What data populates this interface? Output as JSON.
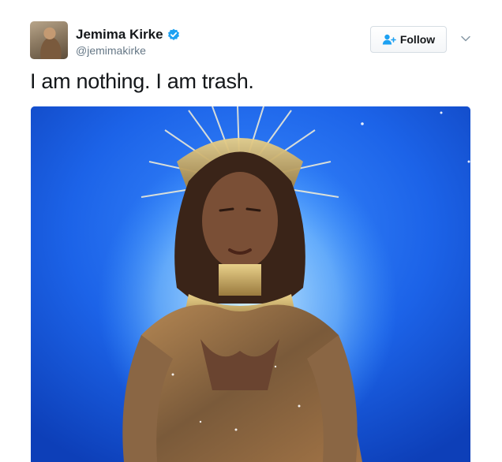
{
  "tweet": {
    "author": {
      "name": "Jemima Kirke",
      "handle": "@jemimakirke",
      "verified": true,
      "avatar_icon": "avatar-photo"
    },
    "follow_button": {
      "label": "Follow",
      "icon": "add-user-icon"
    },
    "more_menu_icon": "chevron-down-icon",
    "text": "I am nothing. I am trash.",
    "media": {
      "type": "photo",
      "alt": ""
    }
  },
  "colors": {
    "text_primary": "#14171a",
    "text_secondary": "#657786",
    "verified_blue": "#1da1f2",
    "media_background": "#1d63e6",
    "button_border": "#d6dde3"
  }
}
